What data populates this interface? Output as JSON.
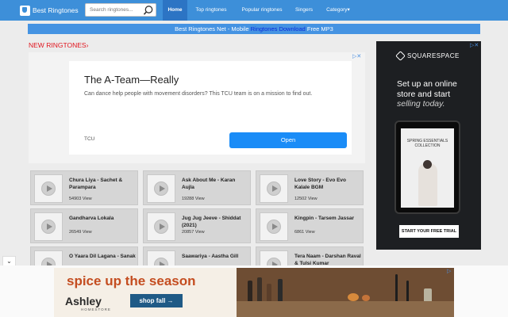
{
  "brand": {
    "name": "Best Ringtones"
  },
  "search": {
    "placeholder": "Search ringtones..."
  },
  "nav": {
    "items": [
      {
        "label": "Home",
        "active": true
      },
      {
        "label": "Top ringtones"
      },
      {
        "label": "Popular ringtones"
      },
      {
        "label": "Singers"
      },
      {
        "label": "Category"
      }
    ]
  },
  "banner": {
    "pre": "Best Ringtones Net - Mobile ",
    "link": "Ringtones Download",
    "post": " Free MP3"
  },
  "section": {
    "title": "NEW RINGTONES"
  },
  "ad_inline": {
    "title": "The A-Team—Really",
    "body": "Can dance help people with movement disorders? This TCU team is on a mission to find out.",
    "advertiser": "TCU",
    "cta": "Open"
  },
  "ad_side": {
    "brand": "SQUARESPACE",
    "lines": [
      "Set up an online",
      "store and start"
    ],
    "tagline": "selling today.",
    "screen_title": "SPRING ESSENTIALS COLLECTION",
    "cta": "START YOUR FREE TRIAL"
  },
  "ringtones": [
    {
      "title": "Chura Liya - Sachet & Parampara",
      "views": "54903 View"
    },
    {
      "title": "Ask About Me - Karan Aujla",
      "views": "19288 View"
    },
    {
      "title": "Love Story - Evo Evo Kalale BGM",
      "views": "12502 View"
    },
    {
      "title": "Gandharva Lokala",
      "views": "26549 View"
    },
    {
      "title": "Jug Jug Jeeve - Shiddat (2021)",
      "views": "20857 View"
    },
    {
      "title": "Kingpin - Tarsem Jassar",
      "views": "6861 View"
    },
    {
      "title": "O Yaara Dil Lagana - Sanak",
      "views": ""
    },
    {
      "title": "Saawariya - Aastha Gill",
      "views": ""
    },
    {
      "title": "Tera Naam - Darshan Raval & Tulsi Kumar",
      "views": ""
    }
  ],
  "ad_bottom": {
    "headline": "spice up the season",
    "brand": "Ashley",
    "brand_sub": "HOMESTORE",
    "cta": "shop fall →"
  },
  "colors": {
    "nav": "#3d8fd9",
    "nav_active": "#2c74c4",
    "section_title": "#e1151e",
    "ad_button": "#1a8cf7"
  }
}
